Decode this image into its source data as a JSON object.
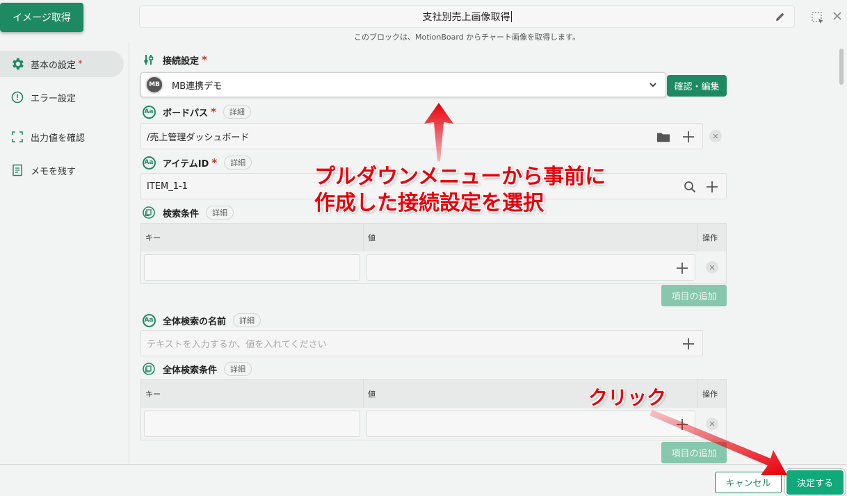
{
  "header": {
    "get_image_button": "イメージ取得",
    "title": "支社別売上画像取得",
    "subtitle": "このブロックは、MotionBoard からチャート画像を取得します。"
  },
  "sidebar": {
    "items": [
      {
        "label": "基本の設定",
        "required": "*",
        "icon": "gear-icon"
      },
      {
        "label": "エラー設定",
        "icon": "alert-circle-icon"
      },
      {
        "label": "出力値を確認",
        "icon": "frame-corners-icon"
      },
      {
        "label": "メモを残す",
        "icon": "note-icon"
      }
    ]
  },
  "form": {
    "connection": {
      "label": "接続設定",
      "required": "*",
      "logo_text": "MB",
      "value": "MB連携デモ",
      "button": "確認・編集"
    },
    "board_path": {
      "label": "ボードパス",
      "required": "*",
      "detail": "詳細",
      "value": "/売上管理ダッシュボード"
    },
    "item_id": {
      "label": "アイテムID",
      "required": "*",
      "detail": "詳細",
      "value": "ITEM_1-1"
    },
    "search_conditions": {
      "label": "検索条件",
      "detail": "詳細",
      "columns": [
        "キー",
        "値",
        "操作"
      ],
      "add_button": "項目の追加"
    },
    "global_search_name": {
      "label": "全体検索の名前",
      "detail": "詳細",
      "placeholder": "テキストを入力するか、値を入れてください"
    },
    "global_search_conditions": {
      "label": "全体検索条件",
      "detail": "詳細",
      "columns": [
        "キー",
        "値",
        "操作"
      ],
      "add_button": "項目の追加"
    }
  },
  "footer": {
    "cancel": "キャンセル",
    "ok": "決定する"
  },
  "annotations": {
    "dropdown_line1": "プルダウンメニューから事前に",
    "dropdown_line2": "作成した接続設定を選択",
    "click": "クリック",
    "arrow_color": "#e8000b"
  },
  "colors": {
    "primary": "#1e8a64",
    "primary_light": "#87c7ae",
    "ok_button": "#0fa97a",
    "required": "#c0392b"
  }
}
